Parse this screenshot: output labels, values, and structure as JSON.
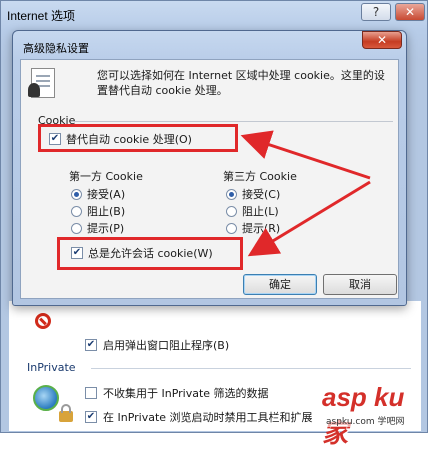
{
  "outer": {
    "title": "Internet 选项",
    "help_label": "?",
    "close_label": "✕",
    "popup_blocker_label": "启用弹出窗口阻止程序(B)",
    "inprivate_section": "InPrivate",
    "inprivate_filter_label": "不收集用于 InPrivate 筛选的数据",
    "inprivate_toolbar_label": "在 InPrivate 浏览启动时禁用工具栏和扩展"
  },
  "dialog": {
    "title": "高级隐私设置",
    "close_label": "✕",
    "description": "您可以选择如何在 Internet 区域中处理 cookie。这里的设置替代自动 cookie 处理。",
    "group_label": "Cookie",
    "override_label": "替代自动 cookie 处理(O)",
    "first_party": {
      "heading": "第一方 Cookie",
      "options": [
        "接受(A)",
        "阻止(B)",
        "提示(P)"
      ],
      "selected": 0
    },
    "third_party": {
      "heading": "第三方 Cookie",
      "options": [
        "接受(C)",
        "阻止(L)",
        "提示(R)"
      ],
      "selected": 0
    },
    "session_label": "总是允许会话 cookie(W)",
    "ok_label": "确定",
    "cancel_label": "取消"
  },
  "watermark": {
    "main": "asp ku 家",
    "sub": "aspku.com 学吧网"
  },
  "colors": {
    "highlight": "#e0282a",
    "titlebar": "#c6d8ef"
  }
}
